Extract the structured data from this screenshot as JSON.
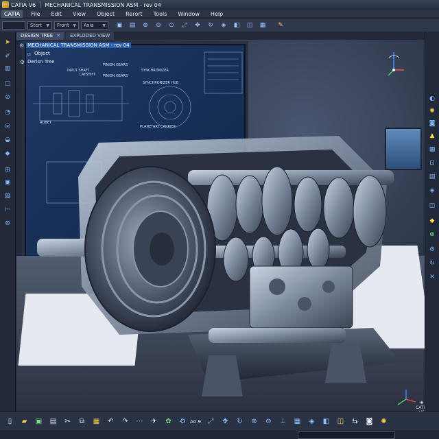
{
  "window": {
    "app_name": "CATIA V6",
    "document_title": "MECHANICAL TRANSMISSION ASM - rev 04"
  },
  "menubar": {
    "brand": "CATIA",
    "items": [
      "File",
      "Edit",
      "View",
      "Object",
      "Rerort",
      "Tools",
      "Window",
      "Help"
    ]
  },
  "toolbar": {
    "fields": [
      {
        "name": "toolbar-field-blank",
        "value": ""
      },
      {
        "name": "toolbar-field-stert",
        "value": "Stert"
      },
      {
        "name": "toolbar-field-front",
        "value": "Front"
      },
      {
        "name": "toolbar-field-asia",
        "value": "Asia"
      }
    ]
  },
  "tabs": [
    {
      "label": "DESIGN TREE",
      "active": true,
      "closable": true
    },
    {
      "label": "EXPLODED VIEW",
      "active": false,
      "closable": false
    }
  ],
  "spec_tree": {
    "root": "MECHANICAL TRANSMISSION ASM - rev 04",
    "items": [
      "Object",
      "Derisn Tree"
    ]
  },
  "blueprint": {
    "labels": [
      "INPUT SHAFT",
      "PINION GEARS",
      "LAYSHIFT",
      "PINION GEARS",
      "SYNCHRONIZER",
      "SYNCHRONIZER HUB",
      "ROBET",
      "PLANETARY CARRIER"
    ]
  },
  "status": {
    "coordinate": "A0.9",
    "product_mark": "CATIA V6"
  },
  "colors": {
    "accent": "#2a5fae",
    "menubar": "#2b3345",
    "toolbar": "#2f384c",
    "viewport": "#2b3447"
  },
  "icons": {
    "left_tools": [
      "select-arrow-icon",
      "sketch-icon",
      "pad-icon",
      "pocket-icon",
      "shaft-icon",
      "groove-icon",
      "hole-icon",
      "fillet-icon",
      "chamfer-icon",
      "constraint-icon",
      "part-icon",
      "assembly-icon",
      "measure-icon",
      "knowledge-icon"
    ],
    "right_tools": [
      "render-icon",
      "light-icon",
      "camera-icon",
      "lock-icon",
      "grid-icon",
      "snap-icon",
      "layers-icon",
      "analysis-icon",
      "section-icon",
      "material-icon",
      "catalog-icon",
      "settings-icon"
    ]
  }
}
